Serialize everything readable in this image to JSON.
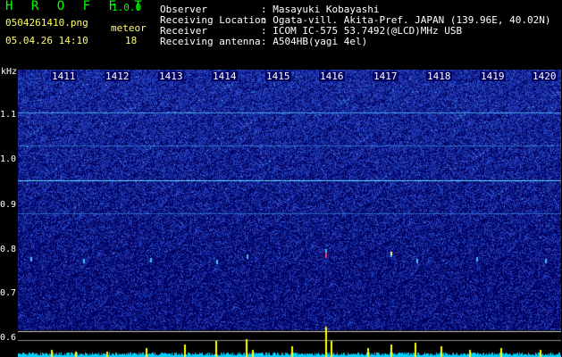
{
  "header": {
    "app_title": "H R O F F T",
    "version": "1.0.0",
    "filename": "0504261410.png",
    "datetime": "05.04.26 14:10",
    "meteor_label": "meteor",
    "meteor_count": "18"
  },
  "info": {
    "observer_label": "Observer",
    "observer_value": ": Masayuki Kobayashi",
    "location_label": "Receiving Location",
    "location_value": ": Ogata-vill. Akita-Pref. JAPAN (139.96E, 40.02N)",
    "receiver_label": "Receiver",
    "receiver_value": ": ICOM IC-575 53.7492(@LCD)MHz USB",
    "antenna_label": "Receiving antenna",
    "antenna_value": ": A504HB(yagi 4el)"
  },
  "axes": {
    "y_unit": "kHz",
    "y_ticks": [
      "1.1",
      "1.0",
      "0.9",
      "0.8",
      "0.7",
      "0.6"
    ],
    "x_ticks": [
      "1411",
      "1412",
      "1413",
      "1414",
      "1415",
      "1416",
      "1417",
      "1418",
      "1419",
      "1420"
    ]
  },
  "colors": {
    "background": "#000000",
    "spectrogram_bg": "#000060",
    "noise": "#3050c0",
    "carrier": "#40c0ff",
    "meteor_peak": "#ffff00",
    "baseline": "#00e0ff",
    "title_green": "#00ff00"
  }
}
